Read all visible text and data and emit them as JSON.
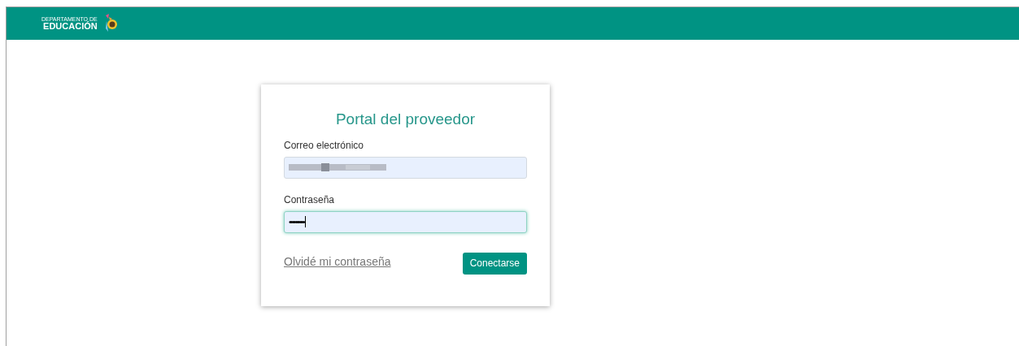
{
  "header": {
    "logo_small": "DEPARTAMENTO DE",
    "logo_big": "EDUCACIÓN"
  },
  "login": {
    "title": "Portal del proveedor",
    "fields": [
      {
        "kind": "redacted",
        "label": "Correo electrónico",
        "focused": false
      },
      {
        "kind": "password",
        "label": "Contraseña",
        "value": "••••••••••",
        "focused": true
      }
    ],
    "forgot_link": "Olvidé mi contraseña",
    "submit": "Conectarse"
  }
}
